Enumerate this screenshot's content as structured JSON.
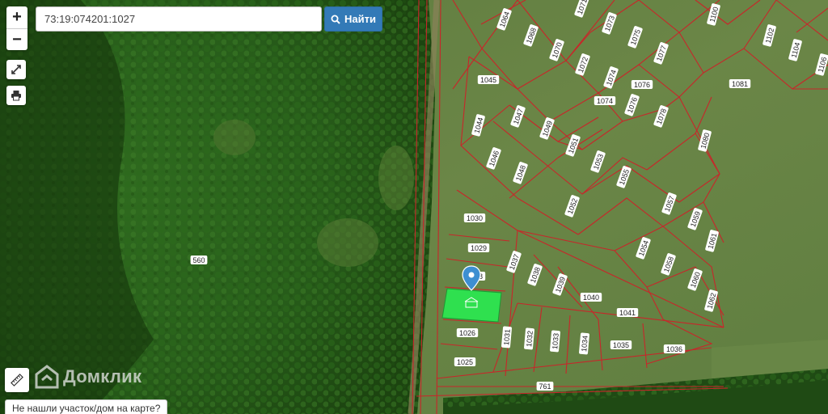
{
  "search": {
    "value": "73:19:074201:1027",
    "button_label": "Найти"
  },
  "logo": {
    "text": "Домклик"
  },
  "bottom_link": {
    "label": "Не нашли участок/дом на карте?"
  },
  "colors": {
    "parcel_stroke": "#c8262a",
    "selected_fill": "#2fe04f",
    "marker": "#3d8fd1",
    "search_button": "#337ab7"
  },
  "icons": [
    "zoom-in-icon",
    "zoom-out-icon",
    "fullscreen-icon",
    "print-icon",
    "search-icon",
    "ruler-icon",
    "location-marker-icon"
  ],
  "parcels": {
    "labels": [
      "1064",
      "1068",
      "1071",
      "1073",
      "1075",
      "1100",
      "1077",
      "1070",
      "1072",
      "1074",
      "1076",
      "1102",
      "1104",
      "1106",
      "1045",
      "1081",
      "1074",
      "1076",
      "1047",
      "1044",
      "1049",
      "1078",
      "1051",
      "1080",
      "1046",
      "1053",
      "1048",
      "1055",
      "1052",
      "1057",
      "1030",
      "1059",
      "1029",
      "1061",
      "1037",
      "1054",
      "1058",
      "1028",
      "1038",
      "1060",
      "1039",
      "1040",
      "1062",
      "1041",
      "1026",
      "1031",
      "1032",
      "1033",
      "1034",
      "1035",
      "1036",
      "1025",
      "761",
      "560"
    ],
    "selected": "1027"
  }
}
